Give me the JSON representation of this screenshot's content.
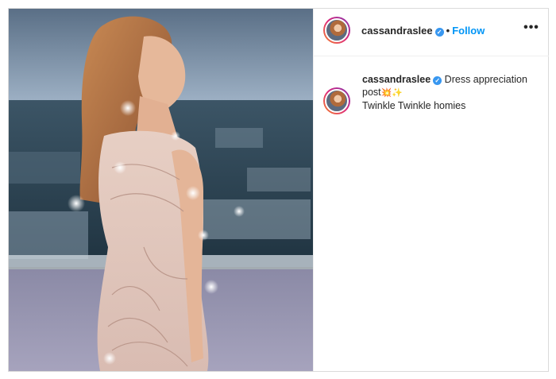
{
  "post": {
    "username": "cassandraslee",
    "follow_label": "Follow",
    "separator": "•",
    "more_icon": "more-horizontal-icon",
    "verified_icon": "verified-badge-icon",
    "caption": {
      "username": "cassandraslee",
      "text_line1": "Dress appreciation",
      "text_line2": "post",
      "emojis": "💥✨",
      "text_line3": "Twinkle Twinkle homies"
    }
  },
  "colors": {
    "accent": "#0095f6",
    "verified": "#3897f0",
    "text": "#262626",
    "border": "#dbdbdb"
  }
}
